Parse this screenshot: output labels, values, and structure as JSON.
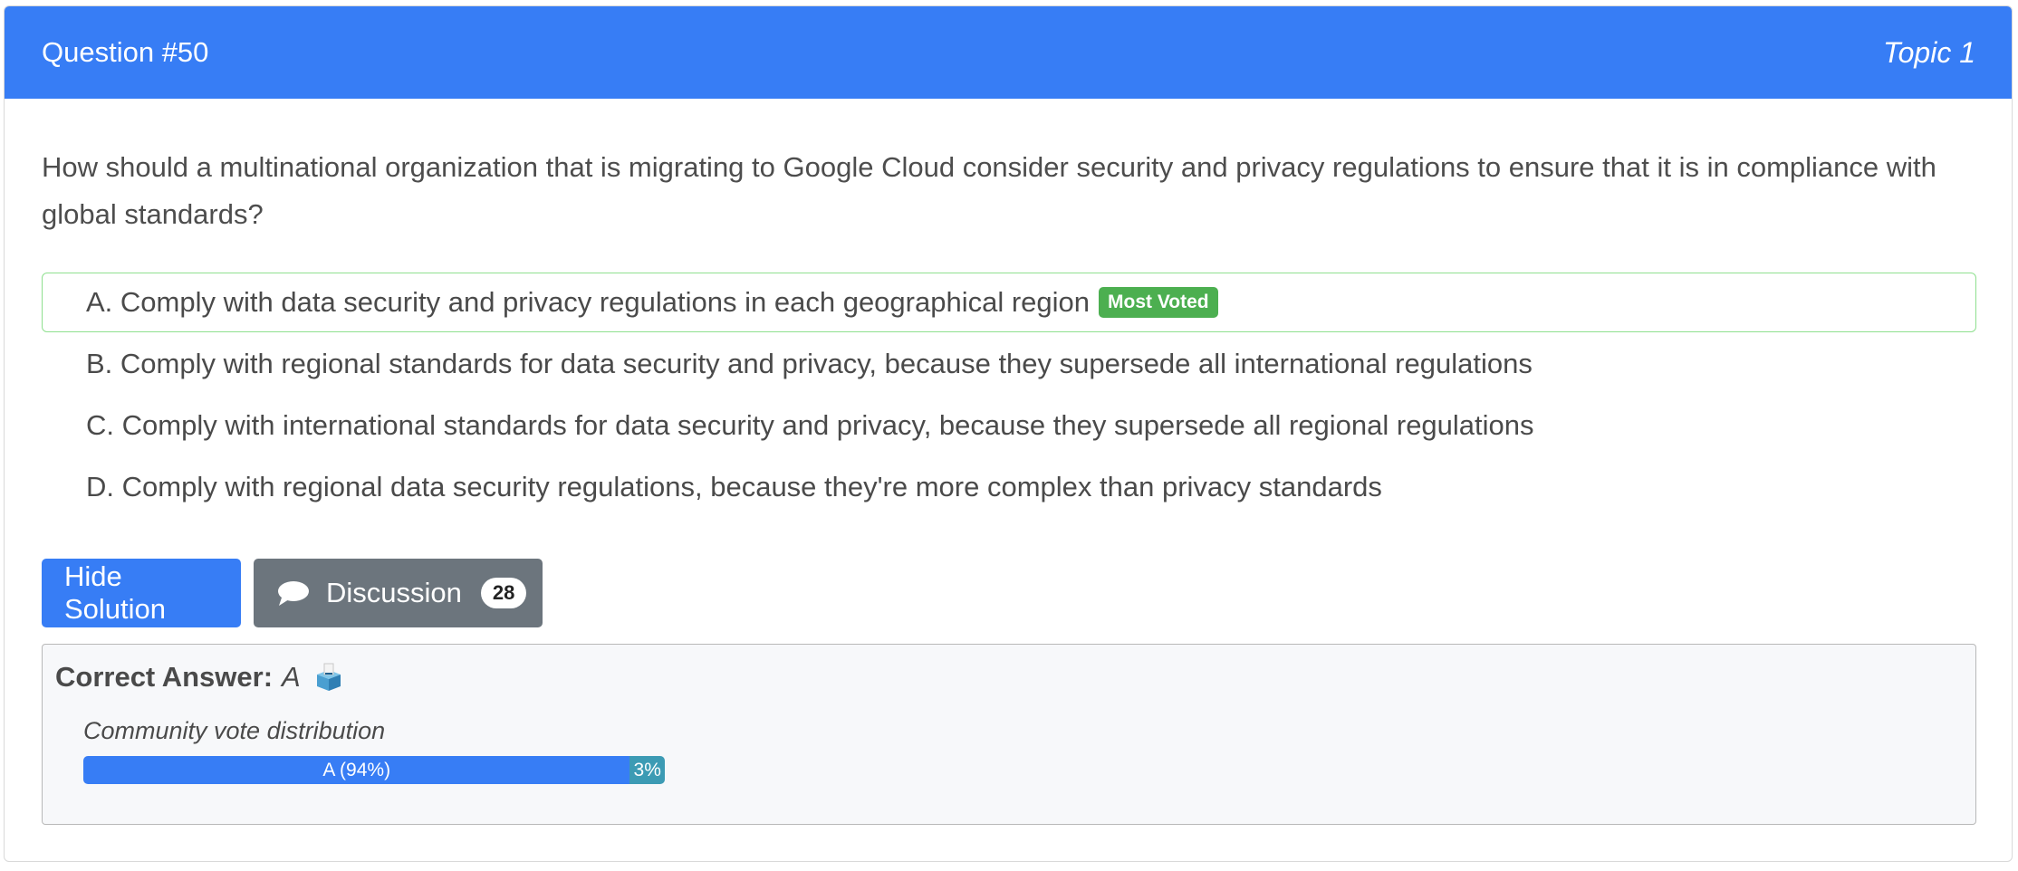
{
  "header": {
    "question_number": "Question #50",
    "topic": "Topic 1",
    "colors": {
      "header_bg": "#377df5"
    }
  },
  "question": {
    "text": "How should a multinational organization that is migrating to Google Cloud consider security and privacy regulations to ensure that it is in compliance with global standards?"
  },
  "choices": [
    {
      "letter": "A.",
      "text": "Comply with data security and privacy regulations in each geographical region",
      "badge": "Most Voted"
    },
    {
      "letter": "B.",
      "text": "Comply with regional standards for data security and privacy, because they supersede all international regulations"
    },
    {
      "letter": "C.",
      "text": "Comply with international standards for data security and privacy, because they supersede all regional regulations"
    },
    {
      "letter": "D.",
      "text": "Comply with regional data security regulations, because they're more complex than privacy standards"
    }
  ],
  "buttons": {
    "hide_solution": "Hide Solution",
    "discussion": "Discussion",
    "discussion_count": "28",
    "discussion_icon": "speech-bubble-icon"
  },
  "answer": {
    "label": "Correct Answer:",
    "value": "A",
    "icon": "ballot-box-icon"
  },
  "votes": {
    "title": "Community vote distribution",
    "segments": [
      {
        "label": "A (94%)",
        "percent": 94,
        "color": "#377df5"
      },
      {
        "label": "3%",
        "percent": 6,
        "color": "#3c9bb4"
      }
    ]
  }
}
